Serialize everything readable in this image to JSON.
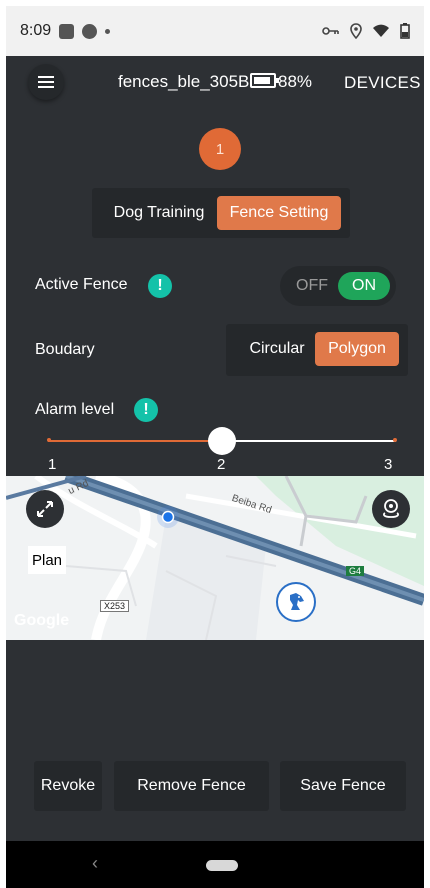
{
  "status_bar": {
    "time": "8:09"
  },
  "header": {
    "device_name": "fences_ble_305B",
    "battery_percent": "88%",
    "battery_level": 0.88,
    "devices_label": "DEVICES"
  },
  "step": {
    "number": "1"
  },
  "mode_tabs": [
    {
      "label": "Dog Training",
      "active": false
    },
    {
      "label": "Fence Setting",
      "active": true
    }
  ],
  "active_fence": {
    "label": "Active Fence",
    "info_mark": "!",
    "off_label": "OFF",
    "on_label": "ON",
    "state": "ON"
  },
  "boundary": {
    "label": "Boudary",
    "options": [
      {
        "label": "Circular",
        "active": false
      },
      {
        "label": "Polygon",
        "active": true
      }
    ]
  },
  "alarm_level": {
    "label": "Alarm level",
    "info_mark": "!",
    "ticks": [
      "1",
      "2",
      "3"
    ],
    "value": 2,
    "min": 1,
    "max": 3
  },
  "map": {
    "plan_label": "Plan",
    "road_labels": {
      "main": "Beiba Rd",
      "small": "u Rd",
      "shield_1": "X253",
      "shield_2": "G4"
    },
    "brand": "Google"
  },
  "actions": {
    "revoke": "Revoke",
    "remove": "Remove Fence",
    "save": "Save Fence"
  },
  "colors": {
    "accent": "#e06a36",
    "toggle_on": "#1fa55a",
    "info": "#14c2a9",
    "app_bg": "#2d3034"
  },
  "icons": {
    "menu": "hamburger-icon",
    "fullscreen": "expand-icon",
    "location": "location-pin-icon",
    "dog": "dog-icon",
    "back": "back-chevron-icon"
  }
}
